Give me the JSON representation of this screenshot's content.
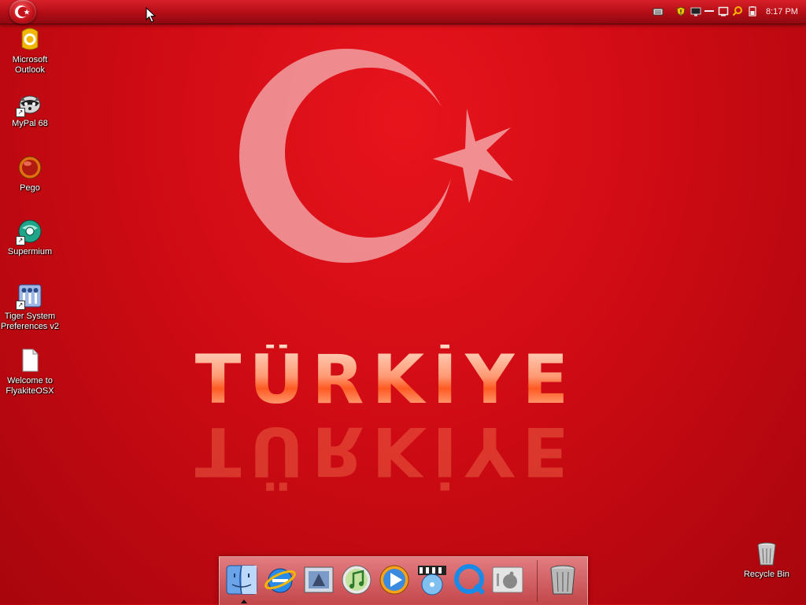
{
  "menubar": {
    "clock": "8:17 PM",
    "tray_icons": [
      "keyboard-icon",
      "shield-icon",
      "monitor-icon",
      "minimize-icon",
      "window-icon",
      "search-icon",
      "battery-icon"
    ]
  },
  "wallpaper": {
    "wordmark": "TÜRKİYE"
  },
  "desktop_icons": [
    {
      "label": "Microsoft Outlook",
      "icon": "outlook-icon"
    },
    {
      "label": "MyPal 68",
      "icon": "mypal-icon"
    },
    {
      "label": "Pego",
      "icon": "pego-icon"
    },
    {
      "label": "Supermium",
      "icon": "supermium-icon"
    },
    {
      "label": "Tiger System Preferences v2",
      "icon": "system-preferences-icon"
    },
    {
      "label": "Welcome to FlyakiteOSX",
      "icon": "document-icon"
    },
    {
      "label": "Recycle Bin",
      "icon": "recycle-bin-icon"
    }
  ],
  "dock": {
    "items": [
      "finder-icon",
      "internet-explorer-icon",
      "mail-icon",
      "itunes-icon",
      "media-player-icon",
      "dvd-player-icon",
      "quicktime-icon",
      "system-preferences-icon",
      "trash-icon"
    ]
  },
  "colors": {
    "flag_red": "#e30a17",
    "menubar_red": "#b30d16",
    "crescent_pink": "#f3a5a8"
  }
}
